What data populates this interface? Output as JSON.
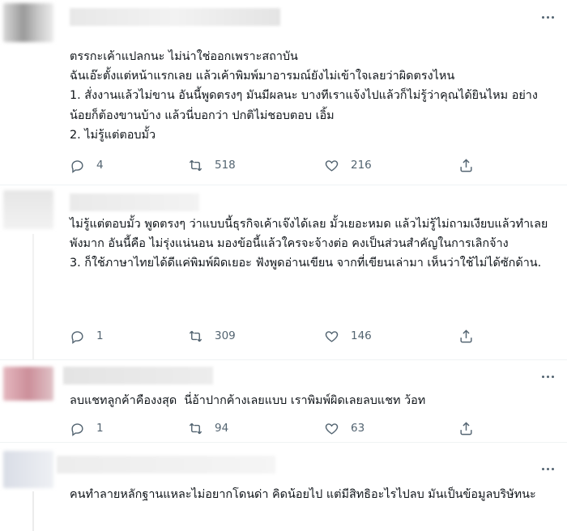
{
  "tweets": [
    {
      "text": "ตรรกะเค้าแปลกนะ ไม่น่าใช่ออกเพราะสถาบัน\nฉันเอ๊ะตั้งแต่หน้าแรกเลย แล้วเค้าพิมพ์มาอารมณ์ยังไม่เข้าใจเลยว่าผิดตรงไหน\n1. สั่งงานแล้วไม่ขาน อันนี้พูดตรงๆ มันมีผลนะ บางทีเราแจ้งไปแล้วก็ไม่รู้ว่าคุณได้ยินไหม อย่างน้อยก็ต้องขานบ้าง แล้วนี่บอกว่า ปกติไม่ชอบตอบ เอิ้ม\n2. ไม่รู้แต่ตอบมั้ว",
      "replies": "4",
      "retweets": "518",
      "likes": "216"
    },
    {
      "text": "ไม่รู้แต่ตอบมั้ว พูดตรงๆ ว่าแบบนี้ธุรกิจเค้าเจ๊งได้เลย มั้วเยอะหมด แล้วไม่รู้ไม่ถามเงียบแล้วทำเลย พังมาก อันนี้คือ ไม่รุ่งแน่นอน มองข้อนี้แล้วใครจะจ้างต่อ คงเป็นส่วนสำคัญในการเลิกจ้าง\n3. ก็ใช้ภาษาไทยได้ดีแค่พิมพ์ผิดเยอะ ฟังพูดอ่านเขียน จากที่เขียนเล่ามา เห็นว่าใช้ไม่ได้ซักด้าน.",
      "replies": "1",
      "retweets": "309",
      "likes": "146"
    },
    {
      "text": "ลบแชทลูกค้าคืองงสุด  นี่อ้าปากค้างเลยแบบ เราพิมพ์ผิดเลยลบแชท ว้อท",
      "replies": "1",
      "retweets": "94",
      "likes": "63"
    },
    {
      "text": "คนทำลายหลักฐานแหละไม่อยากโดนด่า คิดน้อยไป แต่มีสิทธิอะไรไปลบ มันเป็นข้อมูลบริษัทนะ"
    }
  ],
  "colors": {
    "text": "#0f1419",
    "icon": "#536471",
    "divider": "#eff3f4"
  },
  "icons": [
    "more-icon",
    "reply-icon",
    "retweet-icon",
    "like-icon",
    "share-icon"
  ]
}
